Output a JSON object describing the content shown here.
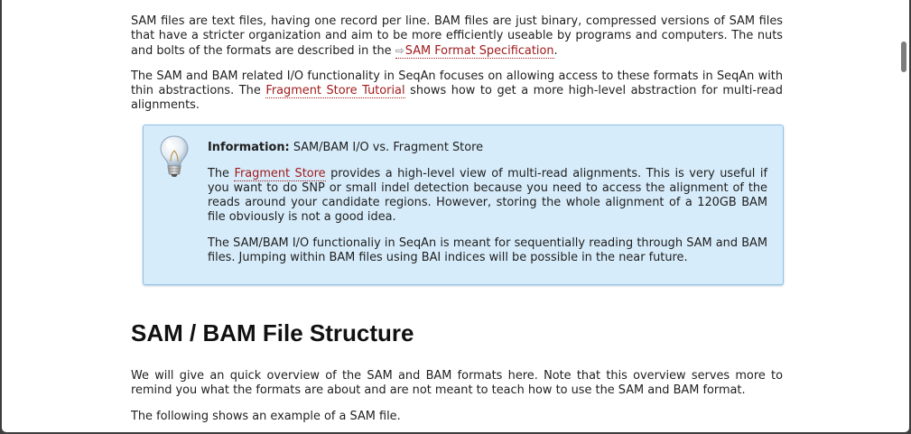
{
  "intro": {
    "clipped_line": "files that have a stricter organization and aim to be more efficiently useable by programs and computers",
    "para1_text": "SAM files are text files, having one record per line. BAM files are just binary, compressed versions of SAM files that have a stricter organization and aim to be more efficiently useable by programs and computers. The nuts and bolts of the formats are described in the ",
    "para1_link": "SAM Format Specification",
    "para1_end": ".",
    "para2_before": "The SAM and BAM related I/O functionality in SeqAn focuses on allowing access to these formats in SeqAn with thin abstractions. The ",
    "para2_link": "Fragment Store Tutorial",
    "para2_after": " shows how to get a more high-level abstraction for multi-read alignments."
  },
  "info_box": {
    "label": "Information:",
    "title": "SAM/BAM I/O vs. Fragment Store",
    "p1_before": "The ",
    "p1_link": "Fragment Store",
    "p1_after": " provides a high-level view of multi-read alignments. This is very useful if you want to do SNP or small indel detection because you need to access the alignment of the reads around your candidate regions. However, storing the whole alignment of a 120GB BAM file obviously is not a good idea.",
    "p2": "The SAM/BAM I/O functionaliy in SeqAn is meant for sequentially reading through SAM and BAM files. Jumping within BAM files using BAI indices will be possible in the near future."
  },
  "section": {
    "heading": "SAM / BAM File Structure",
    "p1": "We will give an quick overview of the SAM and BAM formats here. Note that this overview serves more to remind you what the formats are about and are not meant to teach how to use the SAM and BAM format.",
    "p2": "The following shows an example of a SAM file."
  },
  "icons": {
    "external_link": "⇨",
    "info": "lightbulb-icon"
  },
  "colors": {
    "link": "#a01a1a",
    "info_bg": "#d7ecfa",
    "info_border": "#8fc3e7"
  }
}
